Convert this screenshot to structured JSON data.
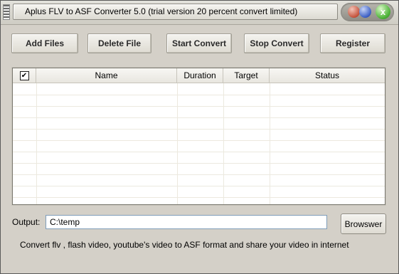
{
  "window": {
    "title": "Aplus FLV to ASF Converter 5.0 (trial version 20 percent convert limited)",
    "close_glyph": "x"
  },
  "toolbar": {
    "add_files": "Add Files",
    "delete_file": "Delete File",
    "start_convert": "Start Convert",
    "stop_convert": "Stop Convert",
    "register": "Register"
  },
  "file_list": {
    "select_all_checked": true,
    "columns": [
      "Name",
      "Duration",
      "Target",
      "Status"
    ],
    "rows": []
  },
  "output": {
    "label": "Output:",
    "path": "C:\\temp",
    "browse_label": "Browswer"
  },
  "info_text": "Convert flv , flash video, youtube's video to ASF format and share your video in internet",
  "icons": {
    "grip": "drag-grip-icon",
    "minimize": "minimize-orb-icon",
    "maximize": "maximize-orb-icon",
    "close": "close-orb-icon",
    "checkbox": "checkmark-icon"
  }
}
